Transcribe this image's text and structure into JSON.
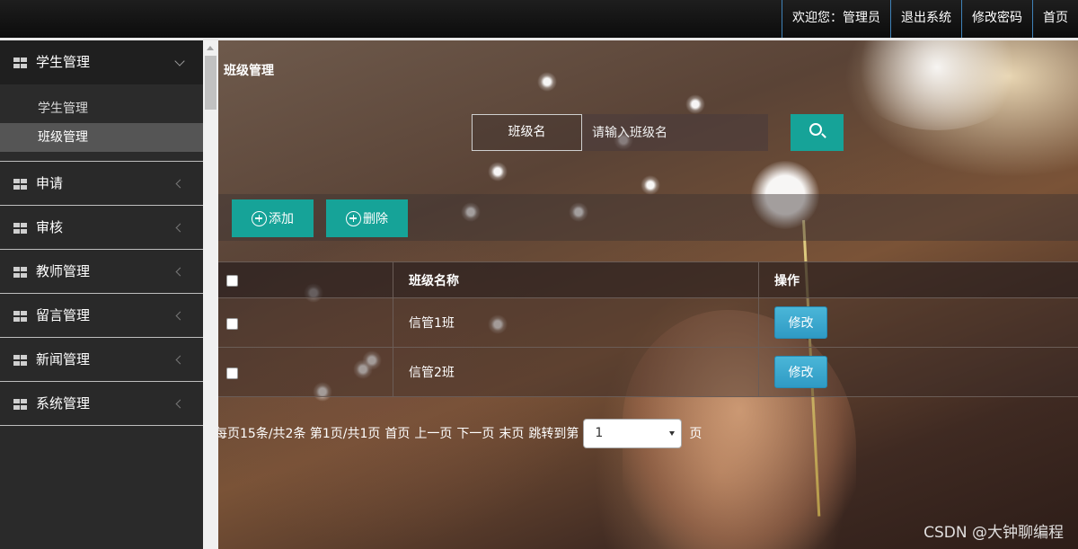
{
  "topnav": {
    "welcome": "欢迎您：管理员",
    "logout": "退出系统",
    "change_password": "修改密码",
    "home": "首页"
  },
  "sidebar": {
    "groups": [
      {
        "label": "学生管理",
        "expanded": true,
        "items": [
          {
            "label": "学生管理",
            "active": false
          },
          {
            "label": "班级管理",
            "active": true
          }
        ]
      },
      {
        "label": "申请"
      },
      {
        "label": "审核"
      },
      {
        "label": "教师管理"
      },
      {
        "label": "留言管理"
      },
      {
        "label": "新闻管理"
      },
      {
        "label": "系统管理"
      }
    ]
  },
  "main": {
    "title": "班级管理",
    "search": {
      "label": "班级名",
      "placeholder": "请输入班级名",
      "button_icon": "search-icon"
    },
    "toolbar": {
      "add_label": "添加",
      "delete_label": "删除"
    },
    "table": {
      "columns": [
        "班级名称",
        "操作"
      ],
      "rows": [
        {
          "name": "信管1班",
          "action": "修改"
        },
        {
          "name": "信管2班",
          "action": "修改"
        }
      ]
    },
    "pager": {
      "summary": "每页15条/共2条 第1页/共1页",
      "first": "首页",
      "prev": "上一页",
      "next": "下一页",
      "last": "末页",
      "jump_prefix": "跳转到第",
      "selected_page": "1",
      "jump_suffix": "页"
    }
  },
  "watermark": "CSDN @大钟聊编程",
  "colors": {
    "accent": "#16a398",
    "edit_button": "#2f9ac4",
    "topbar": "#111111",
    "sidebar": "#2a2a2a"
  }
}
